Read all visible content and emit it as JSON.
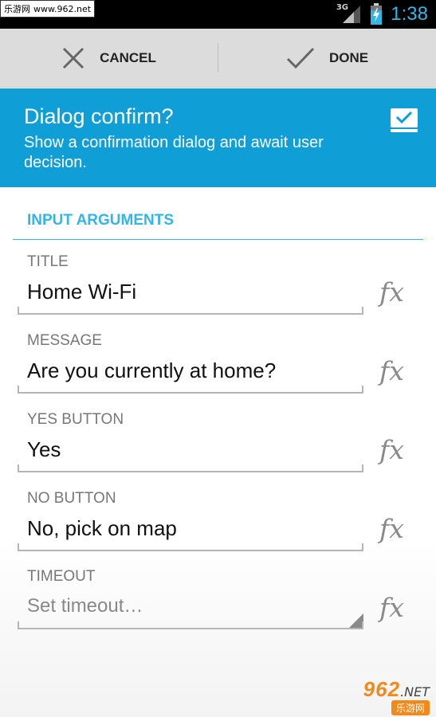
{
  "status_bar": {
    "watermark_site": "乐游网",
    "watermark_url": "www.962.net",
    "network": "3G",
    "time": "1:38"
  },
  "action_bar": {
    "cancel_label": "CANCEL",
    "done_label": "DONE"
  },
  "header": {
    "title": "Dialog confirm?",
    "subtitle": "Show a confirmation dialog and await user decision.",
    "checkbox_checked": true
  },
  "section": {
    "title": "INPUT ARGUMENTS"
  },
  "fields": [
    {
      "label": "TITLE",
      "value": "Home Wi-Fi",
      "fx": "fx"
    },
    {
      "label": "MESSAGE",
      "value": "Are you currently at home?",
      "fx": "fx"
    },
    {
      "label": "YES BUTTON",
      "value": "Yes",
      "fx": "fx"
    },
    {
      "label": "NO BUTTON",
      "value": "No, pick on map",
      "fx": "fx"
    },
    {
      "label": "TIMEOUT",
      "placeholder": "Set timeout…",
      "fx": "fx"
    }
  ],
  "watermark_bottom": {
    "number": "962",
    "suffix": ".NET",
    "site": "乐游网"
  },
  "colors": {
    "accent": "#33b5e5",
    "header_bg": "#0f9fd6",
    "actionbar_bg": "#dcdcdc"
  }
}
